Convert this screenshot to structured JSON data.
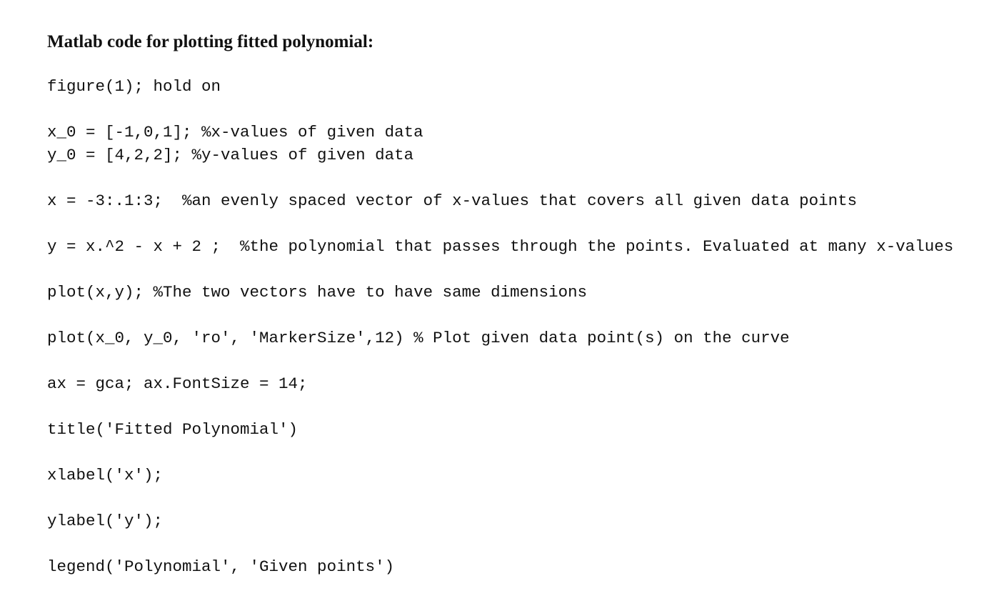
{
  "document": {
    "heading": "Matlab code for plotting fitted polynomial:",
    "code_lines": [
      "figure(1); hold on",
      "x_0 = [-1,0,1]; %x-values of given data",
      "y_0 = [4,2,2]; %y-values of given data",
      "x = -3:.1:3;  %an evenly spaced vector of x-values that covers all given data points",
      "y = x.^2 - x + 2 ;  %the polynomial that passes through the points. Evaluated at many x-values",
      "plot(x,y); %The two vectors have to have same dimensions",
      "plot(x_0, y_0, 'ro', 'MarkerSize',12) % Plot given data point(s) on the curve",
      "ax = gca; ax.FontSize = 14;",
      "title('Fitted Polynomial')",
      "xlabel('x');",
      "ylabel('y');",
      "legend('Polynomial', 'Given points')"
    ]
  }
}
